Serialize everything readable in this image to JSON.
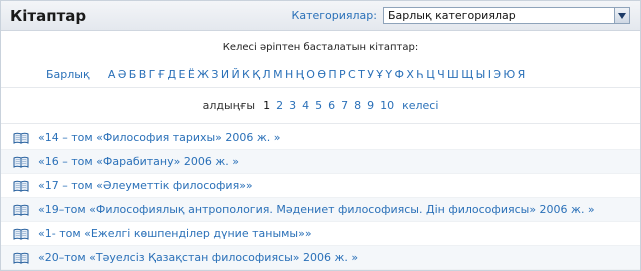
{
  "header": {
    "title": "Кітаптар",
    "category_label": "Категориялар:",
    "category_selected": "Барлық категориялар"
  },
  "alphabet": {
    "intro": "Келесі әріптен басталатын кітаптар:",
    "all_label": "Барлық",
    "letters": [
      "А",
      "Ә",
      "Б",
      "В",
      "Г",
      "Ғ",
      "Д",
      "Е",
      "Ё",
      "Ж",
      "З",
      "И",
      "Й",
      "К",
      "Қ",
      "Л",
      "М",
      "Н",
      "Ң",
      "О",
      "Ө",
      "П",
      "Р",
      "С",
      "Т",
      "У",
      "Ұ",
      "Ү",
      "Ф",
      "Х",
      "Һ",
      "Ц",
      "Ч",
      "Ш",
      "Щ",
      "Ы",
      "І",
      "Э",
      "Ю",
      "Я"
    ]
  },
  "pager": {
    "prev_label": "алдыңғы",
    "current": "1",
    "pages": [
      "2",
      "3",
      "4",
      "5",
      "6",
      "7",
      "8",
      "9",
      "10"
    ],
    "next_label": "келесі"
  },
  "books": [
    "«14 – том «Философия тарихы» 2006 ж. »",
    "«16 – том «Фарабитану» 2006 ж. »",
    "«17 – том «Әлеуметтік философия»»",
    "«19–том «Философиялық антропология. Мәдениет философиясы. Дін философиясы» 2006 ж. »",
    "«1- том «Ежелгі көшпенділер дүние танымы»»",
    "«20–том «Тәуелсіз Қазақстан философиясы» 2006 ж. »"
  ],
  "colors": {
    "link": "#2a70b8",
    "header_bg": "#e4e8ee",
    "border": "#c9d2dc"
  },
  "icons": {
    "book": "open-book-icon",
    "dropdown": "chevron-down-icon"
  }
}
